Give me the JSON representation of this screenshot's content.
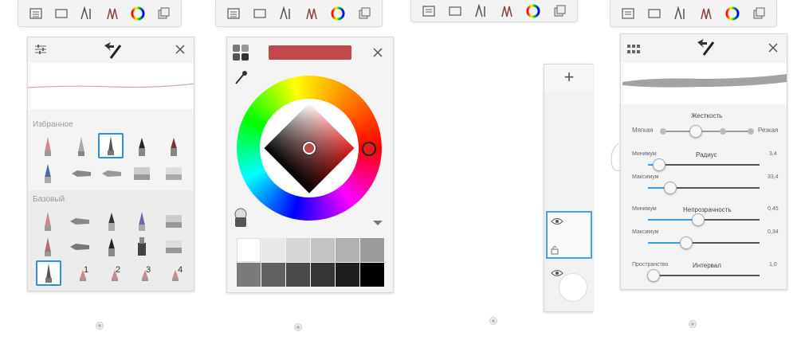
{
  "toolbar": {
    "icons": [
      "list-icon",
      "window-icon",
      "brush-ai-icon",
      "brush-set-icon",
      "color-wheel-icon",
      "layers-icon"
    ]
  },
  "brush_panel": {
    "favorites_label": "Избранное",
    "basic_label": "Базовый",
    "custom_numbers": [
      "1",
      "2",
      "3",
      "4"
    ]
  },
  "color_panel": {
    "current_color": "#c0474a",
    "grays": [
      "#ffffff",
      "#e9e9e9",
      "#d6d6d6",
      "#c3c3c3",
      "#b0b0b0",
      "#9c9c9c",
      "#7a7a7a",
      "#616161",
      "#4a4a4a",
      "#353535",
      "#1f1f1f",
      "#000000"
    ]
  },
  "layers_panel": {
    "add_symbol": "+"
  },
  "brush_props": {
    "hardness": {
      "title": "Жесткость",
      "soft": "Мягкая",
      "hard": "Резкая"
    },
    "radius": {
      "min_label": "Минимум",
      "title": "Радиус",
      "min_value": "3,4",
      "max_label": "Максимум",
      "max_value": "33,4",
      "min_level": 0.1,
      "max_level": 0.2
    },
    "opacity": {
      "min_label": "Минимум",
      "title": "Непрозрачность",
      "min_value": "0,45",
      "max_label": "Максимум",
      "max_value": "0,34",
      "min_level": 0.45,
      "max_level": 0.34
    },
    "spacing": {
      "label": "Пространство",
      "title": "Интервал",
      "value": "1,0",
      "level": 0.05
    }
  },
  "colors": {
    "accent": "#2f8fdc",
    "slider_blue": "#3d9ae8"
  }
}
